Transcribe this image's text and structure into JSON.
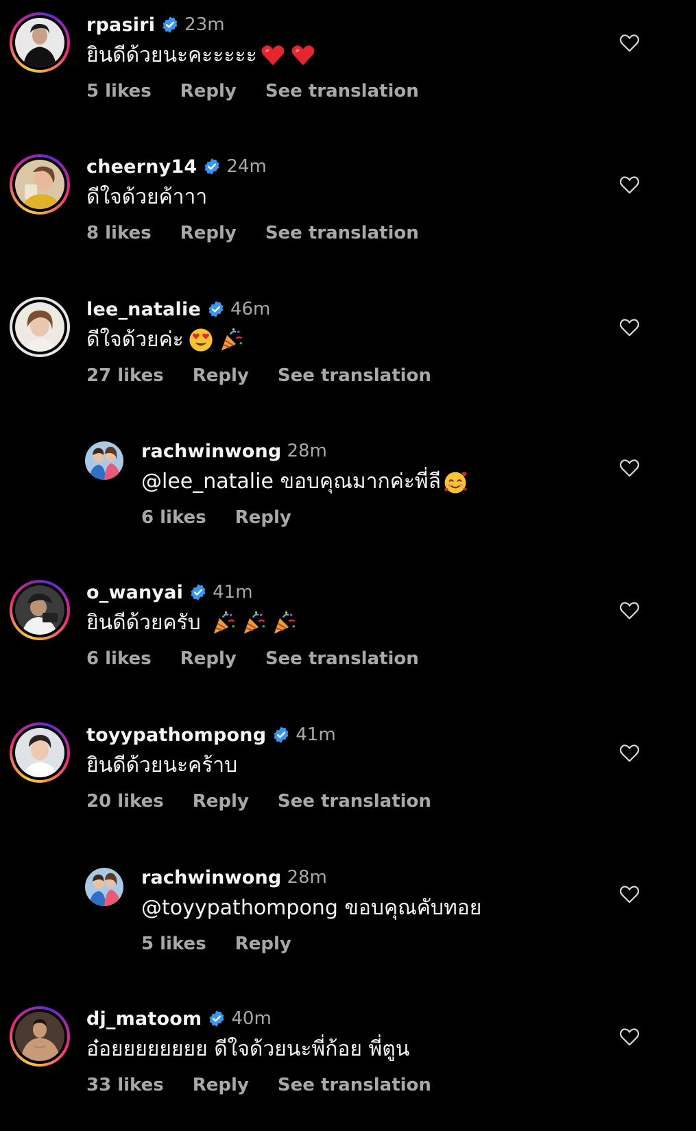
{
  "comments": [
    {
      "username": "rpasiri",
      "verified": true,
      "time": "23m",
      "text": "ยินดีด้วยนะคะะะะะ",
      "emojis": [
        "heart-emoji",
        "heart-emoji"
      ],
      "likes": "5 likes",
      "reply_label": "Reply",
      "translate_label": "See translation"
    },
    {
      "username": "cheerny14",
      "verified": true,
      "time": "24m",
      "text": "ดีใจด้วยค้าาา",
      "emojis": [],
      "likes": "8 likes",
      "reply_label": "Reply",
      "translate_label": "See translation"
    },
    {
      "username": "lee_natalie",
      "verified": true,
      "time": "46m",
      "text": "ดีใจด้วยค่ะ",
      "emojis": [
        "heart-eyes-emoji",
        "party-popper-emoji"
      ],
      "likes": "27 likes",
      "reply_label": "Reply",
      "translate_label": "See translation"
    },
    {
      "username": "rachwinwong",
      "verified": false,
      "time": "28m",
      "text": "@lee_natalie ขอบคุณมากค่ะพี่ลี",
      "emojis": [
        "smiling-face-with-hearts-emoji"
      ],
      "likes": "6 likes",
      "reply_label": "Reply",
      "is_reply": true
    },
    {
      "username": "o_wanyai",
      "verified": true,
      "time": "41m",
      "text": "ยินดีด้วยครับ",
      "emojis": [
        "party-popper-emoji",
        "party-popper-emoji",
        "party-popper-emoji"
      ],
      "likes": "6 likes",
      "reply_label": "Reply",
      "translate_label": "See translation"
    },
    {
      "username": "toyypathompong",
      "verified": true,
      "time": "41m",
      "text": "ยินดีด้วยนะคร้าบ",
      "emojis": [],
      "likes": "20 likes",
      "reply_label": "Reply",
      "translate_label": "See translation"
    },
    {
      "username": "rachwinwong",
      "verified": false,
      "time": "28m",
      "text": "@toyypathompong ขอบคุณคับทอย",
      "emojis": [],
      "likes": "5 likes",
      "reply_label": "Reply",
      "is_reply": true
    },
    {
      "username": "dj_matoom",
      "verified": true,
      "time": "40m",
      "text": "อ๋อยยยยยยยย ดีใจด้วยนะพี่ก้อย พี่ตูน",
      "emojis": [],
      "likes": "33 likes",
      "reply_label": "Reply",
      "translate_label": "See translation"
    }
  ],
  "colors": {
    "background": "#000000",
    "text_primary": "#f5f5f5",
    "text_secondary": "#a8a8a8",
    "verified_badge": "#3897f0"
  },
  "icons": {
    "like": "heart-outline-icon",
    "verified": "verified-badge-icon"
  }
}
